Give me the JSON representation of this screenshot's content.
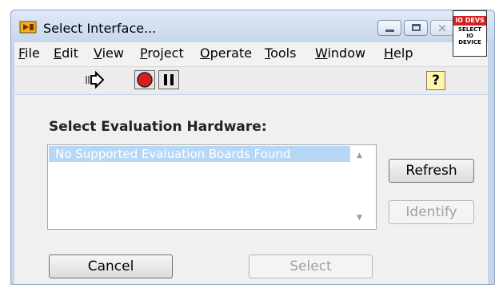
{
  "window": {
    "title": "Select Interface...",
    "minimize_icon": "minimize-icon",
    "maximize_icon": "maximize-icon",
    "close_glyph": "⨯"
  },
  "menu": {
    "items": [
      {
        "u": "F",
        "rest": "ile"
      },
      {
        "u": "E",
        "rest": "dit"
      },
      {
        "u": "V",
        "rest": "iew"
      },
      {
        "u": "P",
        "rest": "roject"
      },
      {
        "u": "O",
        "rest": "perate"
      },
      {
        "u": "T",
        "rest": "ools"
      },
      {
        "u": "W",
        "rest": "indow"
      },
      {
        "u": "H",
        "rest": "elp"
      }
    ]
  },
  "toolbar": {
    "run_icon": "run-arrow-icon",
    "abort_icon": "abort-stop-icon",
    "pause_icon": "pause-icon",
    "help_label": "?"
  },
  "io_box": {
    "header": "IO DEVS",
    "line1": "SELECT",
    "line2": "IO",
    "line3": "DEVICE"
  },
  "main": {
    "heading": "Select Evaluation Hardware:",
    "list_items": [
      "No Supported Evaluation Boards Found"
    ],
    "refresh_label": "Refresh",
    "identify_label": "Identify",
    "cancel_label": "Cancel",
    "select_label": "Select"
  },
  "colors": {
    "list_selection": "#b7d7f7",
    "abort_red": "#d81e1e",
    "io_header_red": "#d61f1f"
  }
}
